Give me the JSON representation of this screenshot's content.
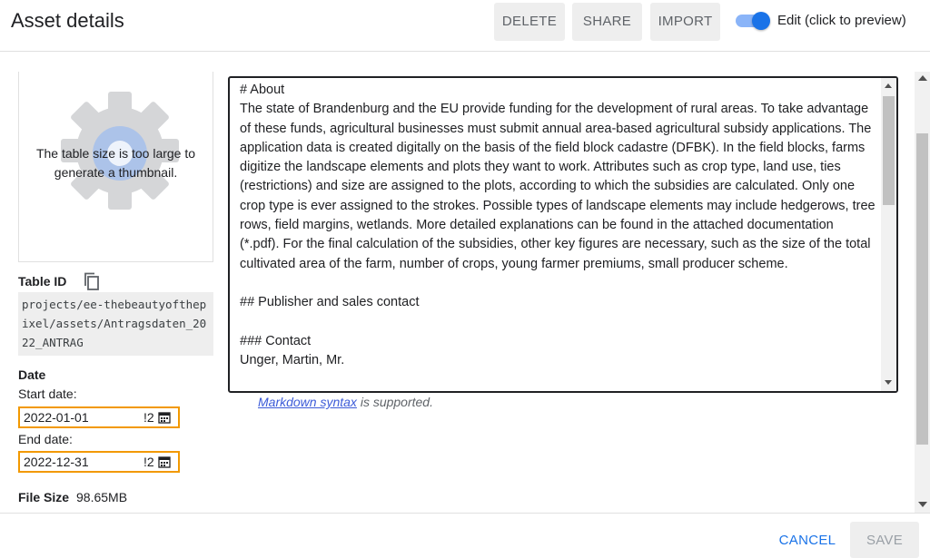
{
  "header": {
    "title": "Asset details",
    "delete_label": "DELETE",
    "share_label": "SHARE",
    "import_label": "IMPORT",
    "edit_toggle_label": "Edit (click to preview)",
    "edit_toggle_on": true
  },
  "thumbnail": {
    "message": "The table size is too large to generate a thumbnail.",
    "icon": "gear-icon"
  },
  "table_id": {
    "label": "Table ID",
    "value": "projects/ee-thebeautyofthepixel/assets/Antragsdaten_2022_ANTRAG"
  },
  "date": {
    "label": "Date",
    "start_label": "Start date:",
    "start_value": "2022-01-01",
    "end_label": "End date:",
    "end_value": "2022-12-31",
    "tail": "!2"
  },
  "file_size": {
    "label": "File Size",
    "value": "98.65MB"
  },
  "editor": {
    "content": "# About\nThe state of Brandenburg and the EU provide funding for the development of rural areas. To take advantage of these funds, agricultural businesses must submit annual area-based agricultural subsidy applications. The application data is created digitally on the basis of the field block cadastre (DFBK). In the field blocks, farms digitize the landscape elements and plots they want to work. Attributes such as crop type, land use, ties (restrictions) and size are assigned to the plots, according to which the subsidies are calculated. Only one crop type is ever assigned to the strokes. Possible types of landscape elements may include hedgerows, tree rows, field margins, wetlands. More detailed explanations can be found in the attached documentation (*.pdf). For the final calculation of the subsidies, other key figures are necessary, such as the size of the total cultivated area of the farm, number of crops, young farmer premiums, small producer scheme.\n\n## Publisher and sales contact\n\n### Contact\nUnger, Martin, Mr."
  },
  "markdown_note": {
    "link": "Markdown syntax",
    "suffix": " is supported."
  },
  "footer": {
    "cancel_label": "CANCEL",
    "save_label": "SAVE"
  },
  "colors": {
    "accent": "#1a73e8",
    "date_border": "#f29900"
  }
}
